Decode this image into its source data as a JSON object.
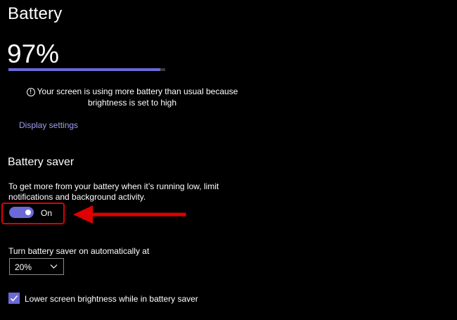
{
  "header": {
    "title": "Battery"
  },
  "battery": {
    "percent_text": "97%",
    "level": 0.97,
    "bar_color": "#6b69d6"
  },
  "notice": {
    "icon": "info-icon",
    "text": "Your screen is using more battery than usual because brightness is set to high"
  },
  "links": {
    "display_settings": "Display settings"
  },
  "battery_saver": {
    "title": "Battery saver",
    "description": "To get more from your battery when it’s running low, limit notifications and background activity.",
    "toggle_state": "On",
    "toggle_on": true,
    "accent_color": "#6b69d6",
    "highlight_color": "#e00000",
    "auto_label": "Turn battery saver on automatically at",
    "auto_threshold": "20%",
    "lower_brightness_label": "Lower screen brightness while in battery saver",
    "lower_brightness_checked": true
  },
  "annotation": {
    "arrow_color": "#e00000"
  }
}
